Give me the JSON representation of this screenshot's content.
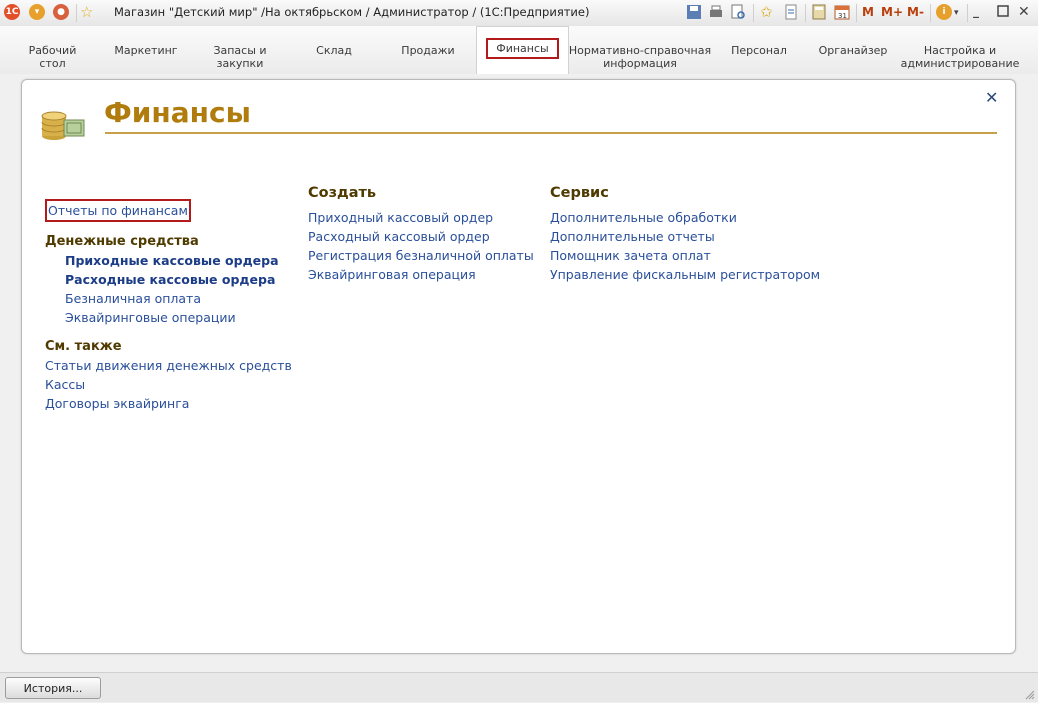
{
  "window": {
    "title": "Магазин \"Детский мир\" /На октябрьском / Администратор /  (1С:Предприятие)",
    "app_icon": "1c-logo-icon",
    "memory_buttons": [
      "M",
      "M+",
      "M-"
    ]
  },
  "sections": [
    {
      "label": "Рабочий\nстол",
      "active": false
    },
    {
      "label": "Маркетинг",
      "active": false
    },
    {
      "label": "Запасы и\nзакупки",
      "active": false
    },
    {
      "label": "Склад",
      "active": false
    },
    {
      "label": "Продажи",
      "active": false
    },
    {
      "label": "Финансы",
      "active": true
    },
    {
      "label": "Нормативно-справочная\nинформация",
      "active": false
    },
    {
      "label": "Персонал",
      "active": false
    },
    {
      "label": "Органайзер",
      "active": false
    },
    {
      "label": "Настройка и\nадминистрирование",
      "active": false
    }
  ],
  "page": {
    "title": "Финансы",
    "left": {
      "reports_link": "Отчеты по финансам",
      "money_title": "Денежные средства",
      "money_items": [
        {
          "label": "Приходные кассовые ордера",
          "bold": true
        },
        {
          "label": "Расходные кассовые ордера",
          "bold": true
        },
        {
          "label": "Безналичная оплата",
          "bold": false
        },
        {
          "label": "Эквайринговые операции",
          "bold": false
        }
      ],
      "see_also_title": "См. также",
      "see_also_items": [
        "Статьи движения денежных средств",
        "Кассы",
        "Договоры эквайринга"
      ]
    },
    "create": {
      "title": "Создать",
      "items": [
        "Приходный кассовый ордер",
        "Расходный кассовый ордер",
        "Регистрация безналичной оплаты",
        "Эквайринговая операция"
      ]
    },
    "service": {
      "title": "Сервис",
      "items": [
        "Дополнительные обработки",
        "Дополнительные отчеты",
        "Помощник зачета оплат",
        "Управление фискальным регистратором"
      ]
    }
  },
  "bottom": {
    "history_button": "История..."
  },
  "colors": {
    "accent": "#b07c0d",
    "link": "#2a4f9a",
    "highlight": "#b31b1b"
  }
}
